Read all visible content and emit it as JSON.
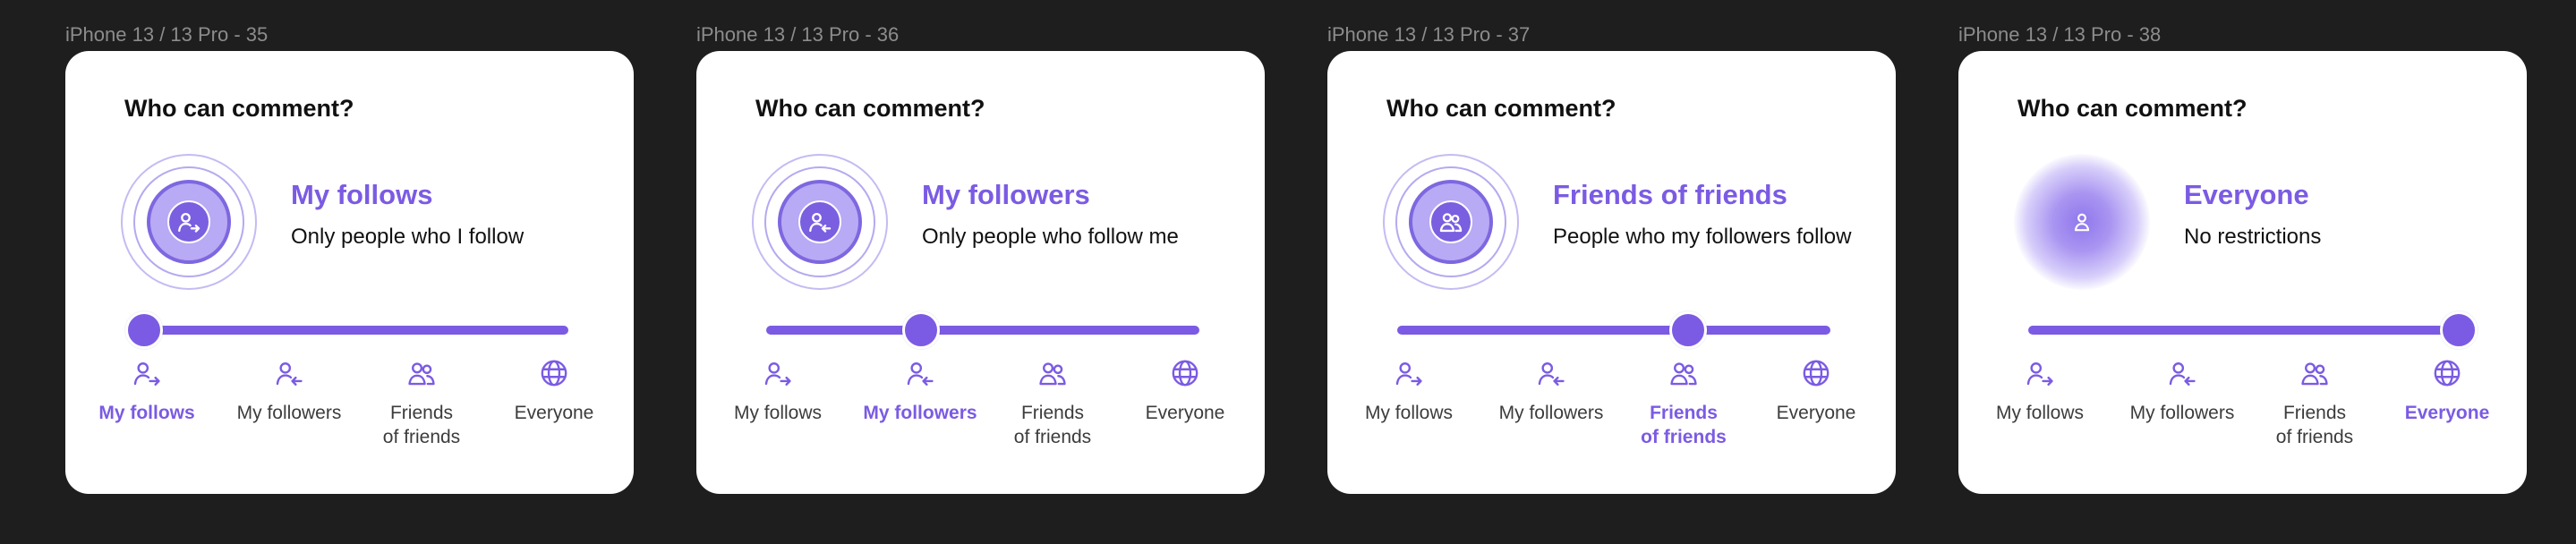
{
  "colors": {
    "canvas_bg": "#1e1e1e",
    "accent": "#7b5be3",
    "card_bg": "#ffffff",
    "frame_label": "#8c8c8c"
  },
  "options": [
    {
      "key": "my_follows",
      "label": "My follows",
      "icon": "user-arrow-right-icon"
    },
    {
      "key": "my_followers",
      "label": "My followers",
      "icon": "user-arrow-left-icon"
    },
    {
      "key": "friends_of_friends",
      "label": "Friends\nof friends",
      "icon": "users-icon"
    },
    {
      "key": "everyone",
      "label": "Everyone",
      "icon": "globe-icon"
    }
  ],
  "frames": [
    {
      "label": "iPhone 13 / 13 Pro - 35",
      "title": "Who can comment?",
      "selected_index": 0,
      "selected_title": "My follows",
      "selected_desc": "Only people who I follow",
      "illustration": "rings",
      "illustration_icon": "user-arrow-right-icon"
    },
    {
      "label": "iPhone 13 / 13 Pro - 36",
      "title": "Who can comment?",
      "selected_index": 1,
      "selected_title": "My followers",
      "selected_desc": "Only people who follow me",
      "illustration": "rings",
      "illustration_icon": "user-arrow-left-icon"
    },
    {
      "label": "iPhone 13 / 13 Pro - 37",
      "title": "Who can comment?",
      "selected_index": 2,
      "selected_title": "Friends of friends",
      "selected_desc": "People who my followers follow",
      "illustration": "rings",
      "illustration_icon": "users-icon"
    },
    {
      "label": "iPhone 13 / 13 Pro - 38",
      "title": "Who can comment?",
      "selected_index": 3,
      "selected_title": "Everyone",
      "selected_desc": "No restrictions",
      "illustration": "glow",
      "illustration_icon": "user-icon"
    }
  ]
}
